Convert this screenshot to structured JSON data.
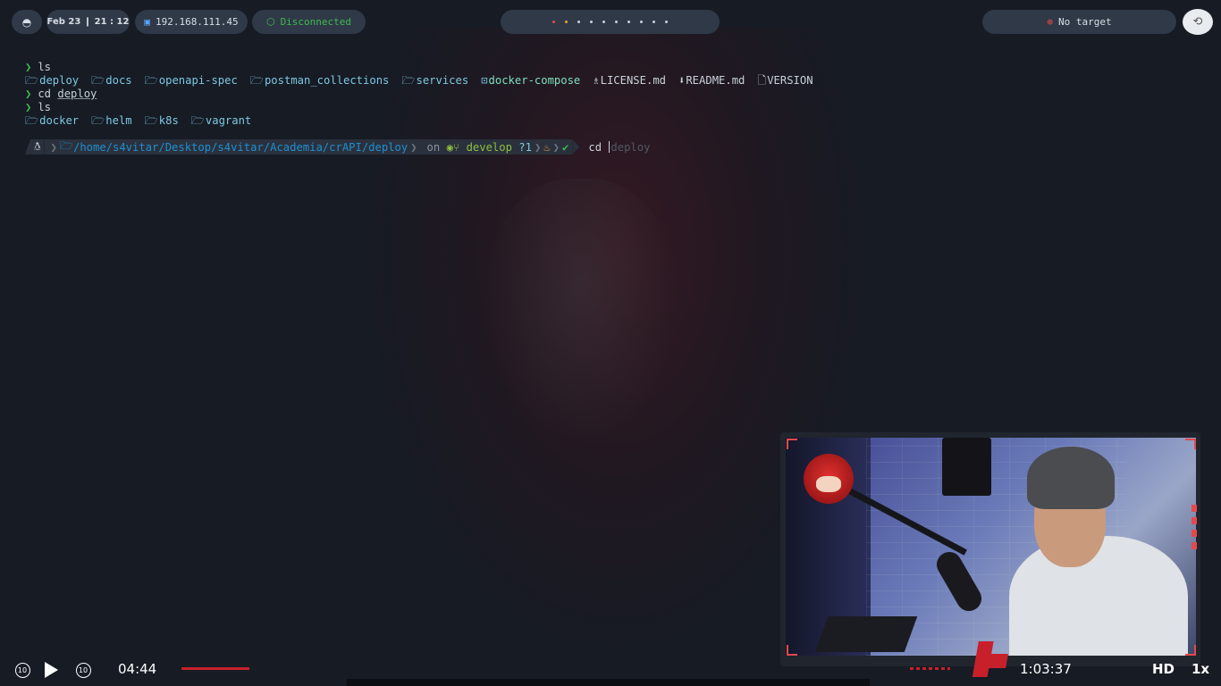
{
  "topbar": {
    "menu_icon": "bolt-circle-icon",
    "date_time": "Feb 23 ❙ 21 : 12",
    "ip_icon": "monitor-icon",
    "ip": "192.168.111.45",
    "vpn_icon": "cube-icon",
    "vpn_status": "Disconnected",
    "workspaces": [
      "red-dot",
      "orange-dot",
      "dot",
      "dot",
      "dot",
      "dot",
      "dot",
      "dot",
      "dot",
      "dot"
    ],
    "target_icon": "crosshair-icon",
    "target": "No target"
  },
  "terminal": {
    "line1_cmd": "ls",
    "ls1": [
      {
        "icon": "folder-icon",
        "name": "deploy",
        "kind": "dir"
      },
      {
        "icon": "folder-icon",
        "name": "docs",
        "kind": "dir"
      },
      {
        "icon": "folder-icon",
        "name": "openapi-spec",
        "kind": "dir"
      },
      {
        "icon": "folder-icon",
        "name": "postman_collections",
        "kind": "dir"
      },
      {
        "icon": "folder-icon",
        "name": "services",
        "kind": "dir"
      },
      {
        "icon": "terminal-icon",
        "name": "docker-compose",
        "kind": "exec"
      },
      {
        "icon": "license-icon",
        "name": "LICENSE.md",
        "kind": "file"
      },
      {
        "icon": "download-icon",
        "name": "README.md",
        "kind": "file"
      },
      {
        "icon": "file-icon",
        "name": "VERSION",
        "kind": "file"
      }
    ],
    "line2_cmd": "cd",
    "line2_arg": "deploy",
    "line3_cmd": "ls",
    "ls2": [
      {
        "icon": "folder-icon",
        "name": "docker",
        "kind": "dir"
      },
      {
        "icon": "folder-icon",
        "name": "helm",
        "kind": "dir"
      },
      {
        "icon": "folder-icon",
        "name": "k8s",
        "kind": "dir"
      },
      {
        "icon": "folder-icon",
        "name": "vagrant",
        "kind": "dir"
      }
    ]
  },
  "prompt": {
    "os_icon": "linux-penguin-icon",
    "path": "/home/s4vitar/Desktop/s4vitar/Academia/crAPI/deploy",
    "on": "on",
    "branch": "develop",
    "git_status": "?1",
    "typed": "cd",
    "suggestion": "deploy"
  },
  "player": {
    "current_time": "04:44",
    "total_time": "1:03:37",
    "progress_fraction": 0.075,
    "quality": "HD",
    "speed": "1x",
    "skip_back_label": "10",
    "skip_fwd_label": "10"
  }
}
